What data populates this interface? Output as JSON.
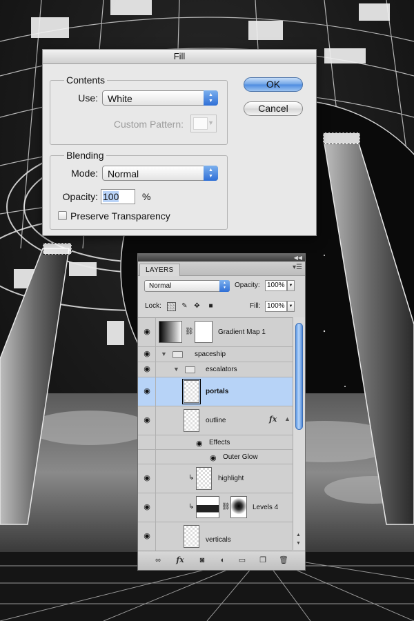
{
  "fill_dialog": {
    "title": "Fill",
    "contents": {
      "legend": "Contents",
      "use_label": "Use:",
      "use_value": "White",
      "custom_pattern_label": "Custom Pattern:"
    },
    "blending": {
      "legend": "Blending",
      "mode_label": "Mode:",
      "mode_value": "Normal",
      "opacity_label": "Opacity:",
      "opacity_value": "100",
      "opacity_unit": "%",
      "preserve_transparency_label": "Preserve Transparency",
      "preserve_transparency_checked": false
    },
    "ok_label": "OK",
    "cancel_label": "Cancel"
  },
  "layers_panel": {
    "tab_label": "LAYERS",
    "blend_mode": "Normal",
    "opacity_label": "Opacity:",
    "opacity_value": "100%",
    "lock_label": "Lock:",
    "fill_label": "Fill:",
    "fill_value": "100%",
    "layers": [
      {
        "name": "Gradient Map 1",
        "type": "adjustment"
      },
      {
        "name": "spaceship",
        "type": "group"
      },
      {
        "name": "escalators",
        "type": "group"
      },
      {
        "name": "portals",
        "type": "layer",
        "selected": true
      },
      {
        "name": "outline",
        "type": "layer",
        "fx": "fx"
      },
      {
        "name": "Effects",
        "type": "effects"
      },
      {
        "name": "Outer Glow",
        "type": "effect"
      },
      {
        "name": "highlight",
        "type": "layer",
        "clipped": true
      },
      {
        "name": "Levels 4",
        "type": "adjustment",
        "clipped": true
      },
      {
        "name": "verticals",
        "type": "layer"
      }
    ],
    "footer_icons": [
      "link-icon",
      "fx-icon",
      "mask-icon",
      "adjustment-icon",
      "folder-icon",
      "new-layer-icon",
      "trash-icon"
    ]
  },
  "colors": {
    "selection_highlight": "#b7d3f7",
    "accent_blue": "#2f6fd6"
  }
}
